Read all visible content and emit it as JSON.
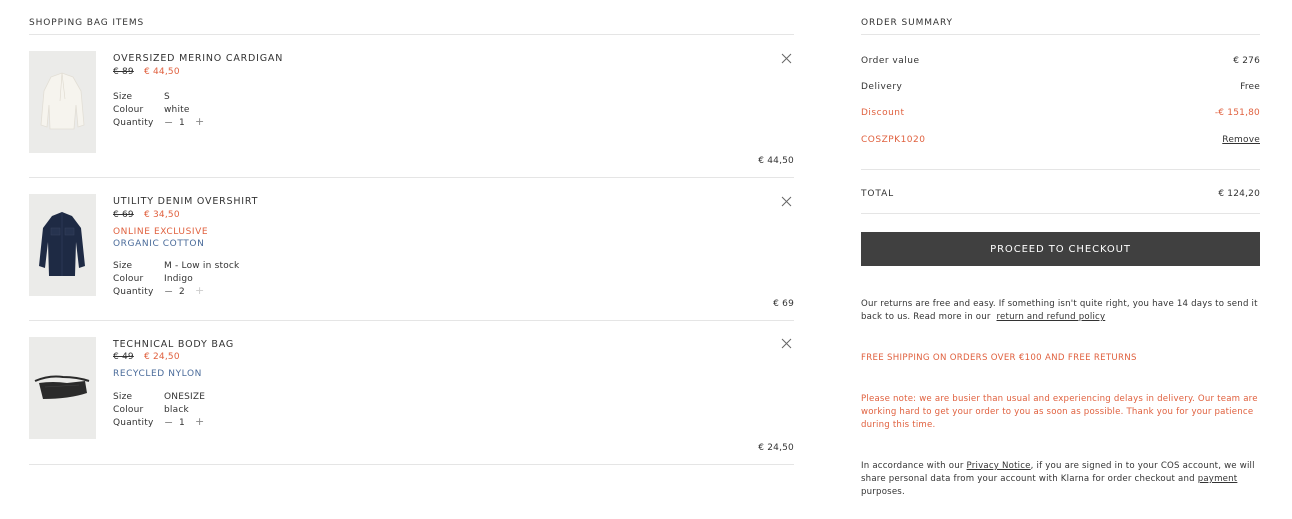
{
  "bag": {
    "title": "SHOPPING BAG ITEMS",
    "items": [
      {
        "name": "OVERSIZED MERINO CARDIGAN",
        "price_old": "€ 89",
        "price_new": "€ 44,50",
        "tags": [],
        "size_label": "Size",
        "size": "S",
        "colour_label": "Colour",
        "colour": "white",
        "qty_label": "Quantity",
        "qty": "1",
        "total": "€ 44,50",
        "image_icon": "cardigan-image"
      },
      {
        "name": "UTILITY DENIM OVERSHIRT",
        "price_old": "€ 69",
        "price_new": "€ 34,50",
        "tags": [
          {
            "text": "ONLINE EXCLUSIVE",
            "color": "#e0613f"
          },
          {
            "text": "ORGANIC COTTON",
            "color": "#4a6b9a"
          }
        ],
        "size_label": "Size",
        "size": "M - Low in stock",
        "colour_label": "Colour",
        "colour": "Indigo",
        "qty_label": "Quantity",
        "qty": "2",
        "total": "€ 69",
        "image_icon": "overshirt-image"
      },
      {
        "name": "TECHNICAL BODY BAG",
        "price_old": "€ 49",
        "price_new": "€ 24,50",
        "tags": [
          {
            "text": "RECYCLED NYLON",
            "color": "#4a6b9a"
          }
        ],
        "size_label": "Size",
        "size": "ONESIZE",
        "colour_label": "Colour",
        "colour": "black",
        "qty_label": "Quantity",
        "qty": "1",
        "total": "€ 24,50",
        "image_icon": "body-bag-image"
      }
    ]
  },
  "summary": {
    "title": "ORDER SUMMARY",
    "order_value_label": "Order value",
    "order_value": "€ 276",
    "delivery_label": "Delivery",
    "delivery": "Free",
    "discount_label": "Discount",
    "discount": "-€ 151,80",
    "code": "COSZPK1020",
    "remove_label": "Remove",
    "total_label": "TOTAL",
    "total": "€ 124,20",
    "checkout_label": "PROCEED TO CHECKOUT",
    "returns_text_1": "Our returns are free and easy. If something isn't quite right, you have 14 days to send it",
    "returns_text_2": "back to us. Read more in our",
    "returns_link": "return and refund policy",
    "free_shipping": "FREE SHIPPING ON ORDERS OVER €100 AND FREE RETURNS",
    "note_1": "Please note: we are busier than usual and experiencing delays in delivery. Our team are",
    "note_2": "working hard to get your order to you as soon as possible. Thank you for your patience",
    "note_3": "during this time.",
    "klarna_1a": "In accordance with our",
    "klarna_privacy": "Privacy Notice",
    "klarna_1b": ", if you are signed in to your COS account, we will",
    "klarna_2a": "share personal data from your account with Klarna for order checkout and",
    "klarna_payment": "payment",
    "klarna_3": "purposes."
  },
  "colors": {
    "accent": "#e0613f",
    "blue_tag": "#4a6b9a",
    "button": "#404040",
    "thumb_bg": "#ebebe9"
  }
}
